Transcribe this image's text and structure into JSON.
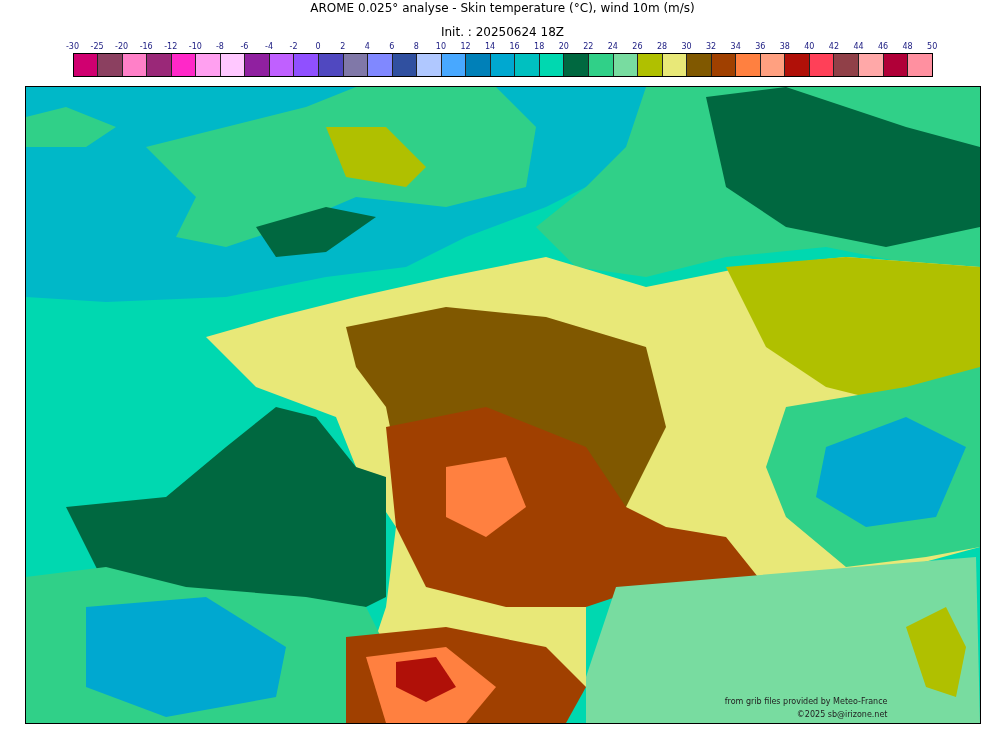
{
  "title": "AROME 0.025° analyse - Skin temperature (°C), wind 10m (m/s)",
  "subtitle": "Init. : 20250624 18Z",
  "colorbar": {
    "ticks": [
      "-30",
      "-25",
      "-20",
      "-16",
      "-12",
      "-10",
      "-8",
      "-6",
      "-4",
      "-2",
      "0",
      "2",
      "4",
      "6",
      "8",
      "10",
      "12",
      "14",
      "16",
      "18",
      "20",
      "22",
      "24",
      "26",
      "28",
      "30",
      "32",
      "34",
      "36",
      "38",
      "40",
      "42",
      "44",
      "46",
      "48",
      "50"
    ],
    "swatches": [
      {
        "color": "#d00070"
      },
      {
        "color": "#8b4060"
      },
      {
        "color": "#ff80c8"
      },
      {
        "color": "#9a2878"
      },
      {
        "color": "#ff28c8"
      },
      {
        "color": "#ffa0f0"
      },
      {
        "color": "#ffc8ff"
      },
      {
        "color": "#9020a0"
      },
      {
        "color": "#c060ff"
      },
      {
        "color": "#9050ff"
      },
      {
        "color": "#5048c0"
      },
      {
        "color": "#8078a8"
      },
      {
        "color": "#8088ff"
      },
      {
        "color": "#3050a0"
      },
      {
        "color": "#b0c8ff"
      },
      {
        "color": "#48a8ff"
      },
      {
        "color": "#0080b8"
      },
      {
        "color": "#00a8d0"
      },
      {
        "color": "#00c0c0"
      },
      {
        "color": "#00d8b0"
      },
      {
        "color": "#006840"
      },
      {
        "color": "#30d088"
      },
      {
        "color": "#78dca0"
      },
      {
        "color": "#b0c000"
      },
      {
        "color": "#e8e878"
      },
      {
        "color": "#805800"
      },
      {
        "color": "#a04000"
      },
      {
        "color": "#ff8040"
      },
      {
        "color": "#ffa080"
      },
      {
        "color": "#b01008"
      },
      {
        "color": "#ff4058"
      },
      {
        "color": "#904048"
      },
      {
        "color": "#ffa8a8"
      },
      {
        "color": "#b00038"
      },
      {
        "color": "#ff90a0"
      }
    ]
  },
  "credits": [
    "from grib files provided by Meteo-France",
    "©2025 sb@irizone.net"
  ]
}
